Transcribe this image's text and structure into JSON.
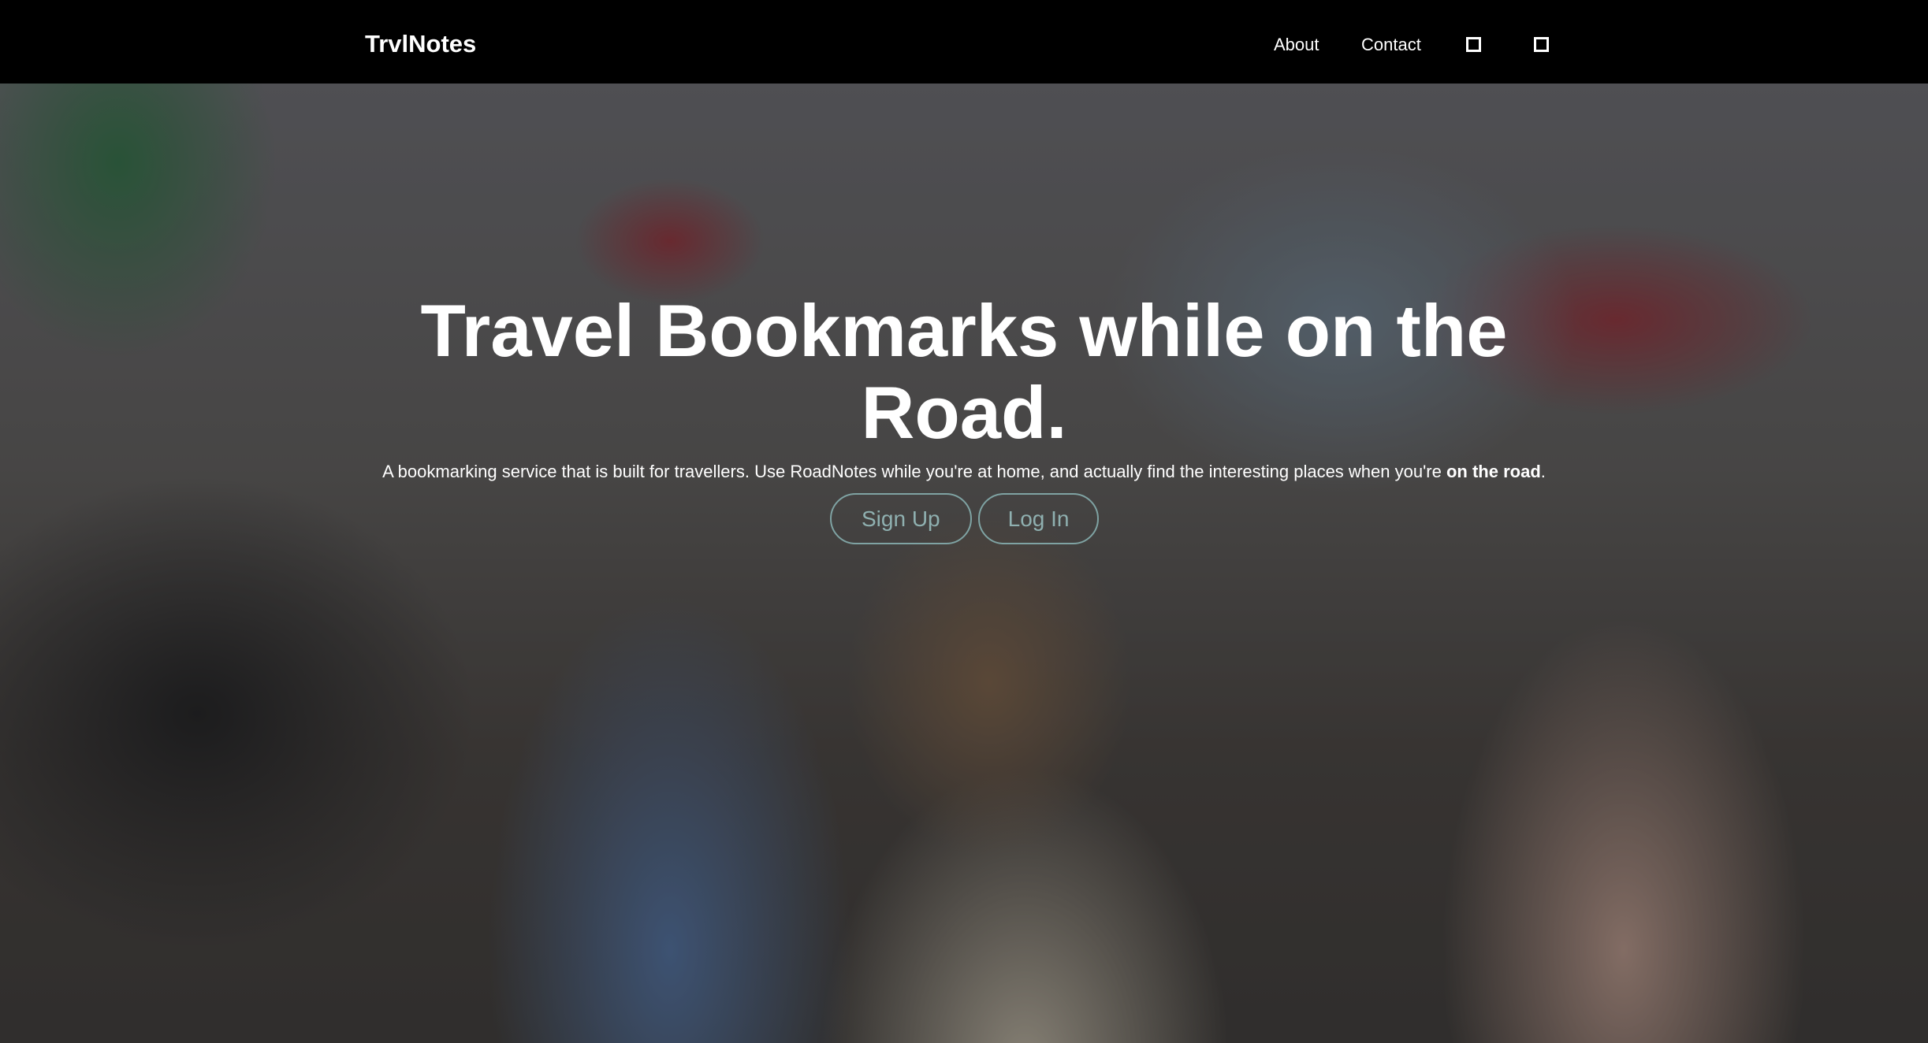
{
  "nav": {
    "brand": "TrvlNotes",
    "links": [
      "About",
      "Contact"
    ],
    "icons": [
      "square-icon",
      "square-icon"
    ]
  },
  "hero": {
    "title": "Travel Bookmarks while on the Road.",
    "subtitle_prefix": "A bookmarking service that is built for travellers. Use RoadNotes while you're at home, and actually find the interesting places when you're ",
    "subtitle_bold": "on the road",
    "subtitle_suffix": ".",
    "signup": "Sign Up",
    "login": "Log In",
    "button_color": "#7fa3a3"
  }
}
